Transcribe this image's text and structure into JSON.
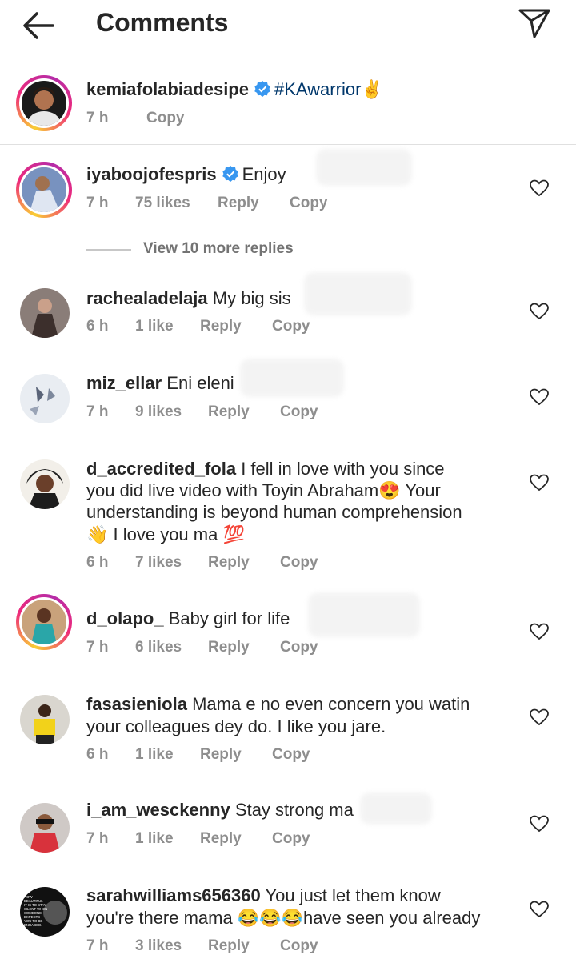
{
  "header": {
    "title": "Comments",
    "back_icon": "arrow-left-icon",
    "send_icon": "paper-plane-icon"
  },
  "caption": {
    "username": "kemiafolabiadesipe",
    "verified": true,
    "text": "#KAwarrior✌️",
    "time": "7 h",
    "copy": "Copy"
  },
  "comments": [
    {
      "username": "iyaboojofespris",
      "verified": true,
      "text": "Enjoy",
      "time": "7 h",
      "likes": "75 likes",
      "reply": "Reply",
      "copy": "Copy"
    },
    {
      "username": "rachealadelaja",
      "text": "My big sis",
      "time": "6 h",
      "likes": "1 like",
      "reply": "Reply",
      "copy": "Copy"
    },
    {
      "username": "miz_ellar",
      "text": "Eni eleni",
      "time": "7 h",
      "likes": "9 likes",
      "reply": "Reply",
      "copy": "Copy"
    },
    {
      "username": "d_accredited_fola",
      "line1": "I fell in love with you since",
      "line2": "you did live video with Toyin Abraham😍 Your",
      "line3": "understanding is beyond human comprehension",
      "line4": "👋 I love you ma 💯",
      "time": "6 h",
      "likes": "7 likes",
      "reply": "Reply",
      "copy": "Copy"
    },
    {
      "username": "d_olapo_",
      "text": "Baby girl for life",
      "time": "7 h",
      "likes": "6 likes",
      "reply": "Reply",
      "copy": "Copy"
    },
    {
      "username": "fasasieniola",
      "line1": "Mama e no even concern you watin",
      "line2": "your colleagues dey do. I like you jare.",
      "time": "6 h",
      "likes": "1 like",
      "reply": "Reply",
      "copy": "Copy"
    },
    {
      "username": "i_am_wesckenny",
      "text": "Stay strong ma",
      "time": "7 h",
      "likes": "1 like",
      "reply": "Reply",
      "copy": "Copy"
    },
    {
      "username": "sarahwilliams656360",
      "line1": "You just let them know",
      "line2": "you're there mama 😂😂😂have seen you already",
      "time": "7 h",
      "likes": "3 likes",
      "reply": "Reply",
      "copy": "Copy"
    }
  ],
  "view_more": "View 10 more replies",
  "avatar_badge_text": [
    "HOW",
    "BEAUTIFUL",
    "IT IS TO STAY",
    "SILENT WHEN",
    "SOMEONE",
    "EXPECTS",
    "YOU TO BE",
    "ENRAGED."
  ],
  "colors": {
    "text": "#262626",
    "meta": "#8e8e8e",
    "link": "#00376b",
    "verified": "#3897f0"
  }
}
